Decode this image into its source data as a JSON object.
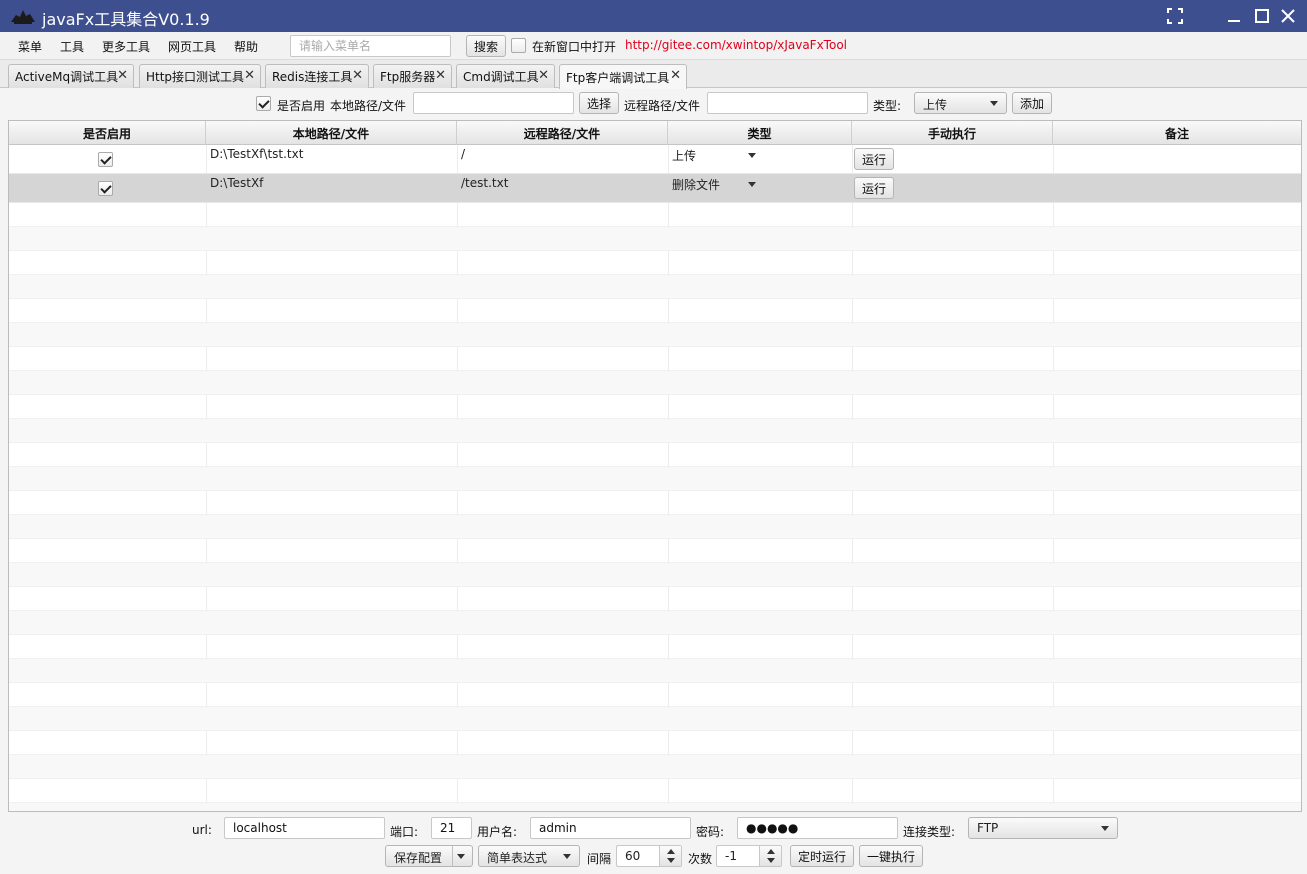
{
  "window": {
    "title": "javaFx工具集合V0.1.9"
  },
  "menubar": {
    "items": [
      "菜单",
      "工具",
      "更多工具",
      "网页工具",
      "帮助"
    ],
    "search_placeholder": "请输入菜单名",
    "search_button": "搜索",
    "new_window_label": "在新窗口中打开",
    "link": "http://gitee.com/xwintop/xJavaFxTool"
  },
  "tabs": [
    {
      "label": "ActiveMq调试工具",
      "active": false
    },
    {
      "label": "Http接口测试工具",
      "active": false
    },
    {
      "label": "Redis连接工具",
      "active": false
    },
    {
      "label": "Ftp服务器",
      "active": false
    },
    {
      "label": "Cmd调试工具",
      "active": false
    },
    {
      "label": "Ftp客户端调试工具",
      "active": true
    }
  ],
  "toolbar": {
    "enabled_label": "是否启用",
    "local_path_label": "本地路径/文件",
    "local_path_value": "",
    "select_button": "选择",
    "remote_path_label": "远程路径/文件",
    "remote_path_value": "",
    "type_label": "类型:",
    "type_value": "上传",
    "add_button": "添加"
  },
  "table": {
    "columns": [
      "是否启用",
      "本地路径/文件",
      "远程路径/文件",
      "类型",
      "手动执行",
      "备注"
    ],
    "rows": [
      {
        "enabled": true,
        "local": "D:\\TestXf\\tst.txt",
        "remote": "/",
        "type": "上传",
        "action": "运行",
        "note": ""
      },
      {
        "enabled": true,
        "local": "D:\\TestXf",
        "remote": "/test.txt",
        "type": "删除文件",
        "action": "运行",
        "note": ""
      }
    ],
    "selected_row": 1
  },
  "footer": {
    "url_label": "url:",
    "url_value": "localhost",
    "port_label": "端口:",
    "port_value": "21",
    "user_label": "用户名:",
    "user_value": "admin",
    "password_label": "密码:",
    "password_value": "●●●●●",
    "conn_type_label": "连接类型:",
    "conn_type_value": "FTP",
    "save_button": "保存配置",
    "cron_mode": "简单表达式",
    "interval_label": "间隔",
    "interval_value": "60",
    "count_label": "次数",
    "count_value": "-1",
    "scheduled_button": "定时运行",
    "run_all_button": "一键执行"
  },
  "colors": {
    "titlebar": "#3e4f8f",
    "link": "#e0001b",
    "selected_row": "#d5d5d5"
  }
}
